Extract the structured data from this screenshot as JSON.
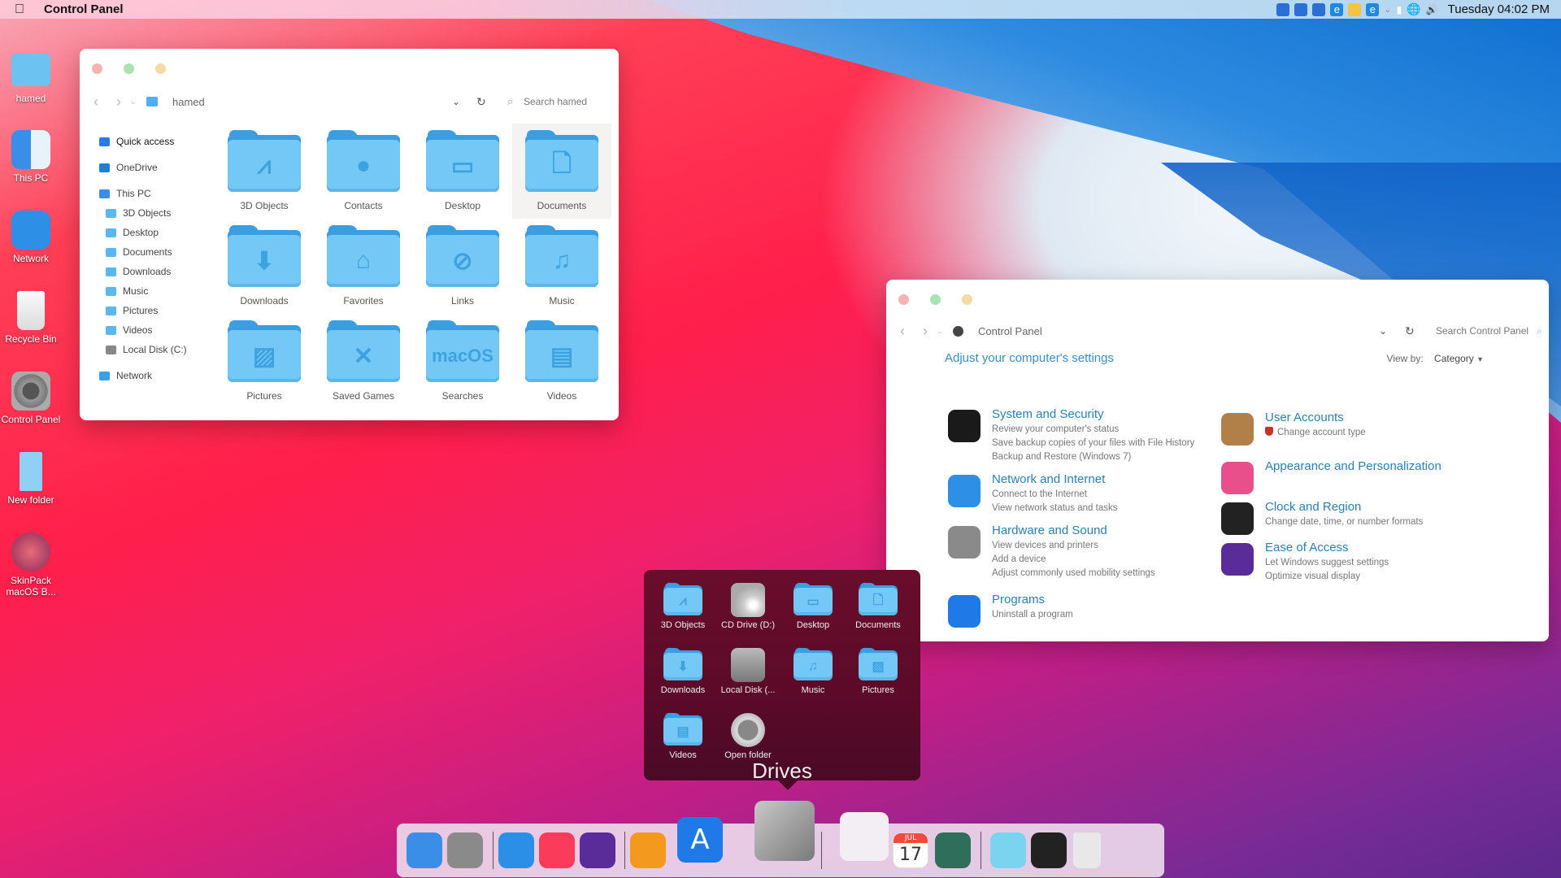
{
  "menubar": {
    "apple_icon": "apple-icon",
    "app_title": "Control Panel",
    "tray_icons": [
      "app-icon",
      "app-icon",
      "app-icon",
      "edge-icon",
      "file-explorer-icon",
      "edge-icon",
      "chevron-down-icon",
      "battery-icon",
      "network-icon",
      "volume-icon"
    ],
    "clock": "Tuesday 04:02 PM"
  },
  "desktop": {
    "icons": [
      {
        "label": "hamed",
        "icon": "user-folder-icon"
      },
      {
        "label": "This PC",
        "icon": "finder-icon"
      },
      {
        "label": "Network",
        "icon": "wifi-icon"
      },
      {
        "label": "Recycle Bin",
        "icon": "trash-icon"
      },
      {
        "label": "Control Panel",
        "icon": "gear-icon"
      },
      {
        "label": "New folder",
        "icon": "folder-icon"
      },
      {
        "label": "SkinPack macOS B...",
        "icon": "skinpack-icon"
      }
    ]
  },
  "explorer": {
    "address": "hamed",
    "search_placeholder": "Search hamed",
    "sidebar": [
      {
        "label": "Quick access",
        "level": 0
      },
      {
        "label": "OneDrive",
        "level": 0
      },
      {
        "label": "This PC",
        "level": 0
      },
      {
        "label": "3D Objects",
        "level": 1
      },
      {
        "label": "Desktop",
        "level": 1
      },
      {
        "label": "Documents",
        "level": 1
      },
      {
        "label": "Downloads",
        "level": 1
      },
      {
        "label": "Music",
        "level": 1
      },
      {
        "label": "Pictures",
        "level": 1
      },
      {
        "label": "Videos",
        "level": 1
      },
      {
        "label": "Local Disk (C:)",
        "level": 1
      },
      {
        "label": "Network",
        "level": 0
      }
    ],
    "items": [
      {
        "label": "3D Objects",
        "glyph": "⩘"
      },
      {
        "label": "Contacts",
        "glyph": "●"
      },
      {
        "label": "Desktop",
        "glyph": "▭"
      },
      {
        "label": "Documents",
        "glyph": "🗋"
      },
      {
        "label": "Downloads",
        "glyph": "⬇"
      },
      {
        "label": "Favorites",
        "glyph": "⌂"
      },
      {
        "label": "Links",
        "glyph": "⊘"
      },
      {
        "label": "Music",
        "glyph": "♫"
      },
      {
        "label": "Pictures",
        "glyph": "▨"
      },
      {
        "label": "Saved Games",
        "glyph": "✕"
      },
      {
        "label": "Searches",
        "glyph": "macOS"
      },
      {
        "label": "Videos",
        "glyph": "▤"
      }
    ],
    "selected_item": "Documents"
  },
  "control_panel": {
    "address": "Control Panel",
    "search_placeholder": "Search Control Panel",
    "heading": "Adjust your computer's settings",
    "view_by_label": "View by:",
    "view_by_value": "Category",
    "left": [
      {
        "title": "System and Security",
        "links": [
          "Review your computer's status",
          "Save backup copies of your files with File History",
          "Backup and Restore (Windows 7)"
        ],
        "icon": "activity-monitor-icon",
        "color": "#1a1a1a"
      },
      {
        "title": "Network and Internet",
        "links": [
          "Connect to the Internet",
          "View network status and tasks"
        ],
        "icon": "wifi-icon",
        "color": "#2d8fe6"
      },
      {
        "title": "Hardware and Sound",
        "links": [
          "View devices and printers",
          "Add a device",
          "Adjust commonly used mobility settings"
        ],
        "icon": "accessibility-icon",
        "color": "#8a8a8a"
      },
      {
        "title": "Programs",
        "links": [
          "Uninstall a program"
        ],
        "icon": "app-store-icon",
        "color": "#1f7ae8"
      }
    ],
    "right": [
      {
        "title": "User Accounts",
        "links": [
          "Change account type"
        ],
        "icon": "contacts-icon",
        "color": "#b08048"
      },
      {
        "title": "Appearance and Personalization",
        "links": [],
        "icon": "personalization-icon",
        "color": "#e94f8a"
      },
      {
        "title": "Clock and Region",
        "links": [
          "Change date, time, or number formats"
        ],
        "icon": "clock-icon",
        "color": "#222222"
      },
      {
        "title": "Ease of Access",
        "links": [
          "Let Windows suggest settings",
          "Optimize visual display"
        ],
        "icon": "siri-icon",
        "color": "#5a2c9a"
      }
    ]
  },
  "drives_popup": {
    "title": "Drives",
    "items": [
      {
        "label": "3D Objects",
        "type": "folder",
        "glyph": "⩘"
      },
      {
        "label": "CD Drive (D:)",
        "type": "cd"
      },
      {
        "label": "Desktop",
        "type": "folder",
        "glyph": "▭"
      },
      {
        "label": "Documents",
        "type": "folder",
        "glyph": "🗋"
      },
      {
        "label": "Downloads",
        "type": "folder",
        "glyph": "⬇"
      },
      {
        "label": "Local Disk (...",
        "type": "disk"
      },
      {
        "label": "Music",
        "type": "folder",
        "glyph": "♫"
      },
      {
        "label": "Pictures",
        "type": "folder",
        "glyph": "▨"
      },
      {
        "label": "Videos",
        "type": "folder",
        "glyph": "▤"
      },
      {
        "label": "Open folder",
        "type": "open"
      }
    ]
  },
  "dock": {
    "items": [
      {
        "name": "finder-icon",
        "color": "#3a8ee8"
      },
      {
        "name": "system-preferences-icon",
        "color": "#8a8a8a"
      },
      {
        "name": "safari-icon",
        "color": "#2b8fe8"
      },
      {
        "name": "music-icon",
        "color": "#fa3c5a"
      },
      {
        "name": "siri-icon",
        "color": "#5a2c9a"
      },
      {
        "name": "home-icon",
        "color": "#f39a1e"
      },
      {
        "name": "app-store-icon",
        "color": "#1f7ae8"
      },
      {
        "name": "drives-icon",
        "color": "#9a9a9a"
      },
      {
        "name": "launchpad-icon",
        "color": "#eeeeee"
      },
      {
        "name": "calendar-icon",
        "color": "#ffffff"
      },
      {
        "name": "time-machine-icon",
        "color": "#2e6e5a"
      },
      {
        "name": "folder-icon",
        "color": "#7ad4f0"
      },
      {
        "name": "mission-control-icon",
        "color": "#222222"
      },
      {
        "name": "trash-icon",
        "color": "#e8e8e8"
      }
    ],
    "calendar_month": "JUL",
    "calendar_day": "17"
  }
}
